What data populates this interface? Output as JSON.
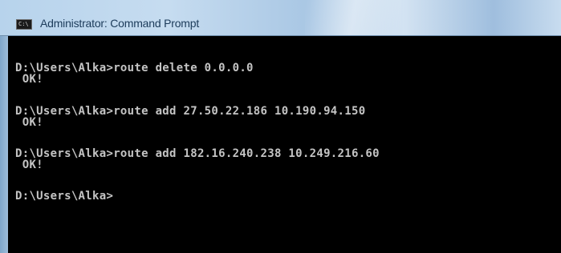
{
  "window": {
    "title": "Administrator: Command Prompt",
    "icon": "command-prompt-icon"
  },
  "console": {
    "lines": [
      "D:\\Users\\Alka>route delete 0.0.0.0",
      " OK!",
      "D:\\Users\\Alka>route add 27.50.22.186 10.190.94.150",
      " OK!",
      "D:\\Users\\Alka>route add 182.16.240.238 10.249.216.60",
      " OK!",
      "D:\\Users\\Alka>"
    ]
  },
  "colors": {
    "console_bg": "#000000",
    "console_text": "#c4c4c4",
    "titlebar": "#b7d3ec",
    "title_text": "#1c3b5a"
  }
}
